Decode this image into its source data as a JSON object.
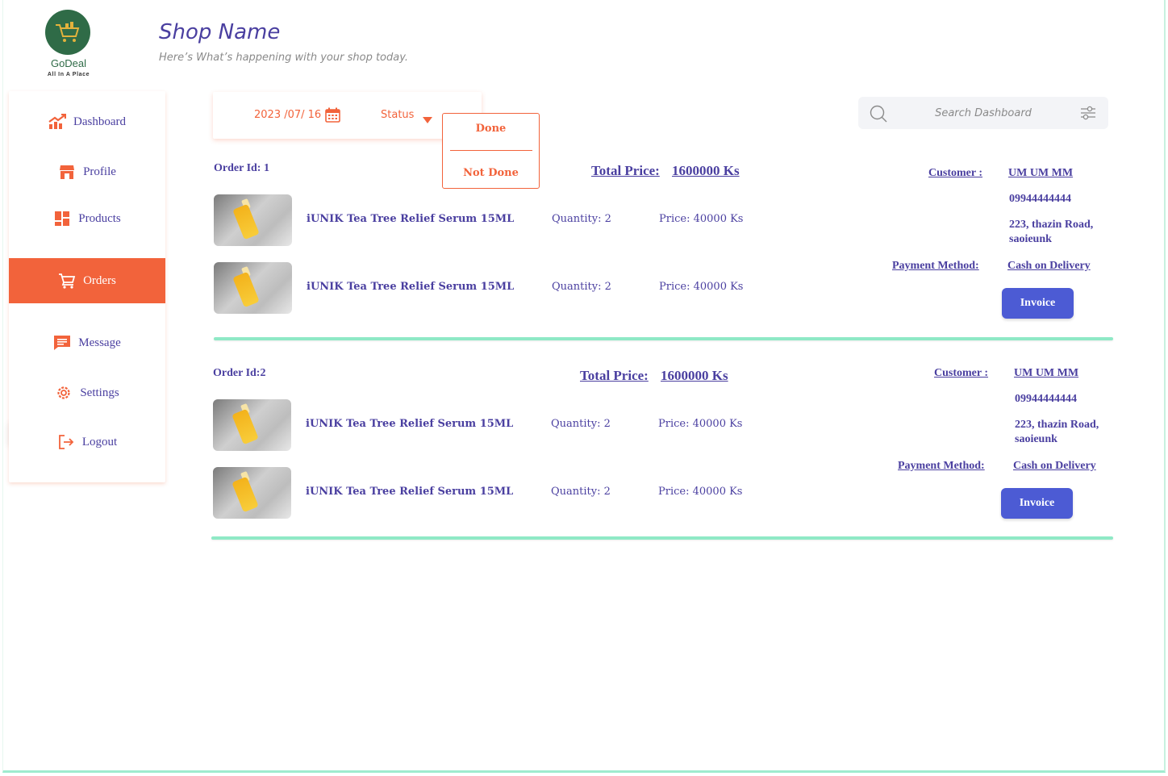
{
  "brand": {
    "name": "GoDeal",
    "tagline": "All In A Place"
  },
  "header": {
    "title": "Shop Name",
    "subtitle": "Here’s  What’s happening with your shop today."
  },
  "sidebar": {
    "items": [
      {
        "label": "Dashboard",
        "icon": "chart-up-icon"
      },
      {
        "label": "Profile",
        "icon": "store-icon"
      },
      {
        "label": "Products",
        "icon": "grid-icon"
      },
      {
        "label": "Orders",
        "icon": "cart-icon",
        "active": true
      },
      {
        "label": "Message",
        "icon": "message-icon"
      },
      {
        "label": "Settings",
        "icon": "gear-icon"
      },
      {
        "label": "Logout",
        "icon": "logout-icon"
      }
    ]
  },
  "filters": {
    "date": "2023 /07/ 16",
    "status_label": "Status",
    "status_options": [
      "Done",
      "Not Done"
    ]
  },
  "search": {
    "placeholder": "Search Dashboard"
  },
  "colors": {
    "accent": "#f2633b",
    "primary": "#4a3fa0",
    "button": "#4c5bd4",
    "divider": "#8fe9c6"
  },
  "orders": [
    {
      "id_label": "Order Id: 1",
      "total_label": "Total Price:",
      "total_value": "1600000 Ks",
      "items": [
        {
          "name": "iUNIK Tea  Tree Relief Serum 15ML",
          "quantity": "Quantity:  2",
          "price": "Price:  40000 Ks"
        },
        {
          "name": "iUNIK Tea  Tree Relief Serum 15ML",
          "quantity": "Quantity:  2",
          "price": "Price:  40000 Ks"
        }
      ],
      "customer_label": "Customer :",
      "customer_name": "UM UM MM",
      "phone": "09944444444",
      "address": "223,  thazin Road, saoieunk",
      "payment_label": "Payment Method:",
      "payment_value": "Cash on Delivery",
      "invoice_label": "Invoice"
    },
    {
      "id_label": "Order Id:2",
      "total_label": "Total Price:",
      "total_value": "1600000 Ks",
      "items": [
        {
          "name": "iUNIK Tea  Tree Relief Serum 15ML",
          "quantity": "Quantity:  2",
          "price": "Price:  40000 Ks"
        },
        {
          "name": "iUNIK Tea  Tree Relief Serum 15ML",
          "quantity": "Quantity:  2",
          "price": "Price:  40000 Ks"
        }
      ],
      "customer_label": "Customer :",
      "customer_name": "UM UM MM",
      "phone": "09944444444",
      "address": "223,  thazin Road, saoieunk",
      "payment_label": "Payment Method:",
      "payment_value": "Cash on Delivery",
      "invoice_label": "Invoice"
    }
  ]
}
